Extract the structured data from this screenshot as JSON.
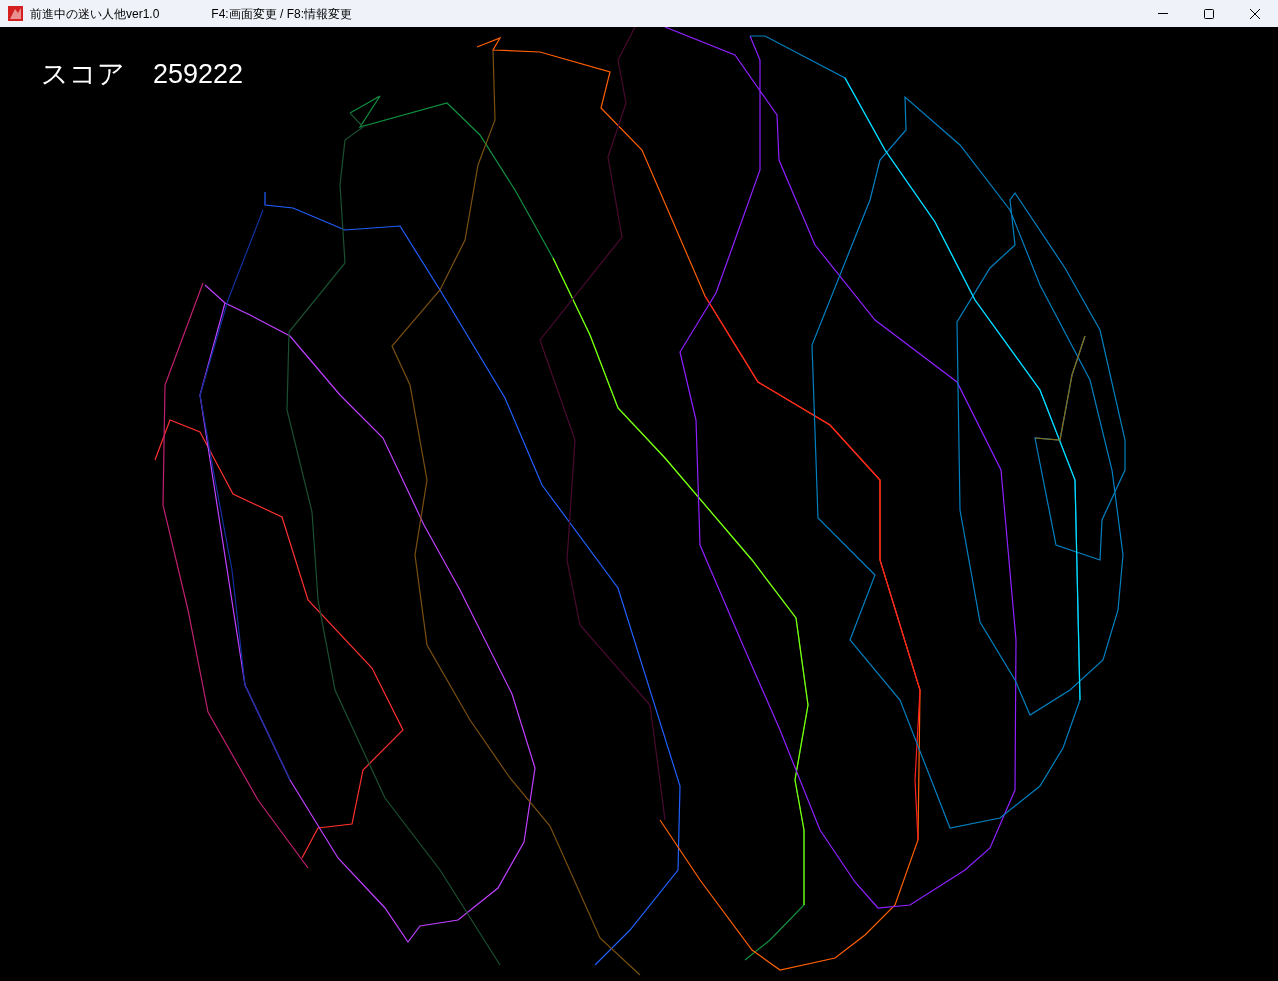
{
  "window": {
    "title": "前進中の迷い人他ver1.0",
    "hint": "F4:画面変更 / F8:情報変更"
  },
  "score": {
    "label": "スコア",
    "value": "259222"
  }
}
